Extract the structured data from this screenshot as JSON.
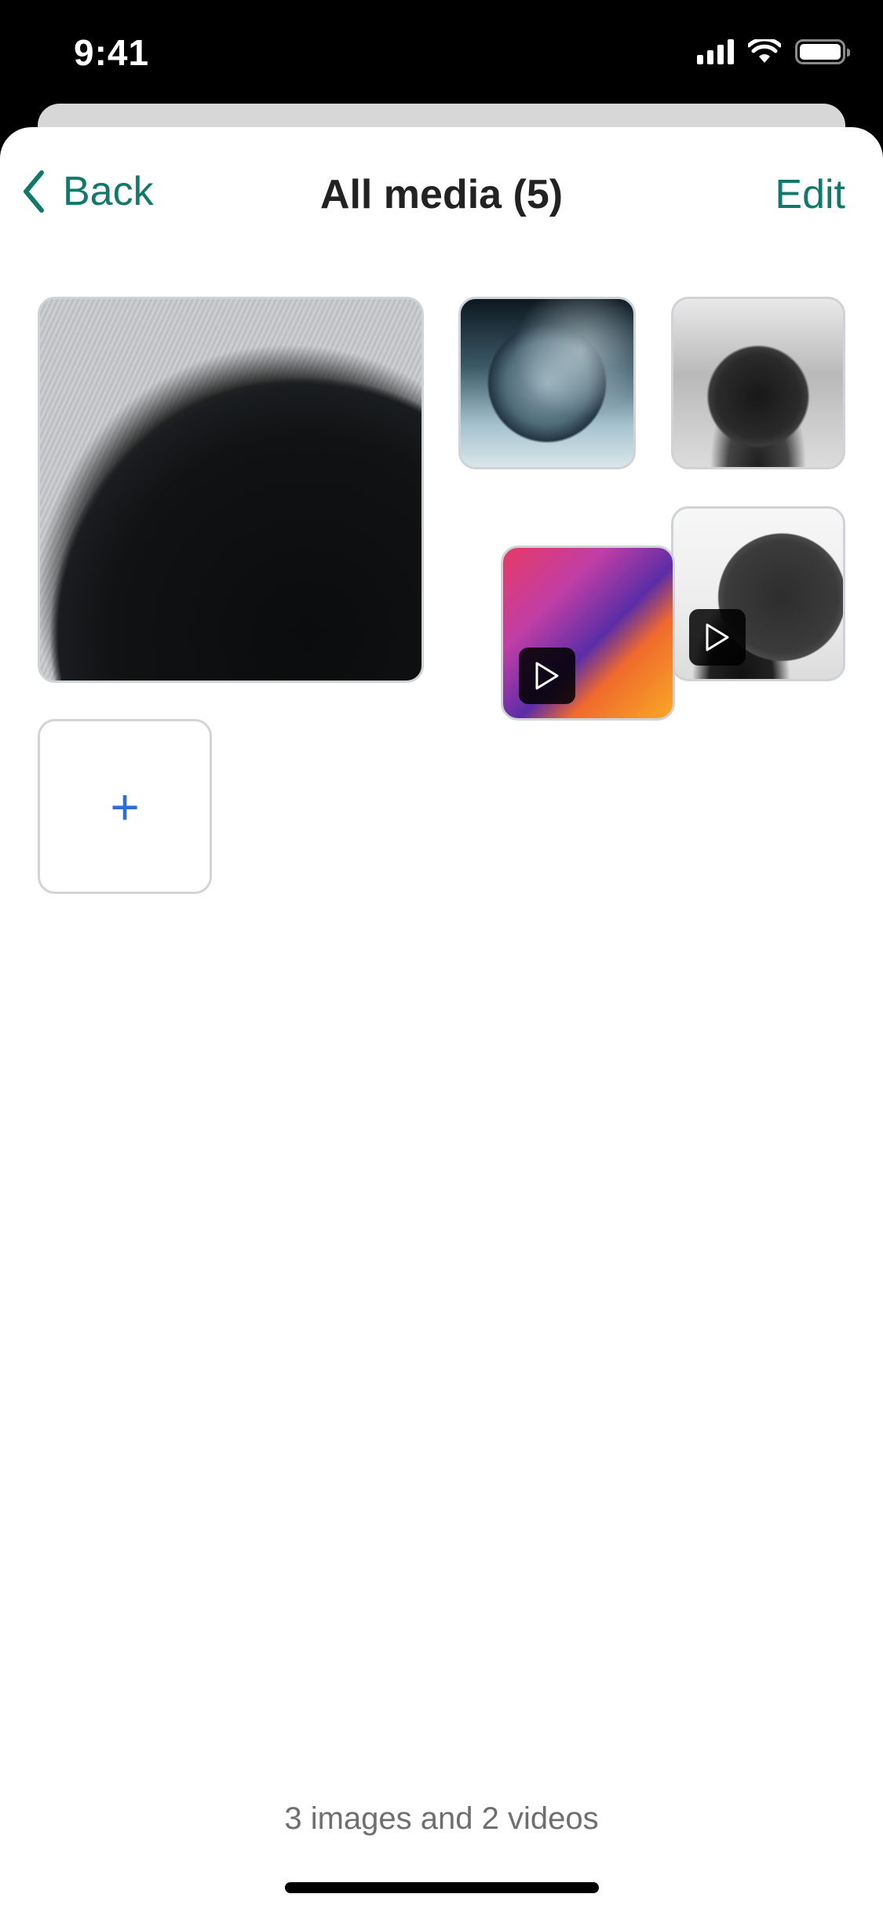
{
  "status_bar": {
    "time": "9:41",
    "icons": [
      "cellular-signal-icon",
      "wifi-icon",
      "battery-icon"
    ]
  },
  "nav": {
    "back_label": "Back",
    "title": "All media (5)",
    "edit_label": "Edit"
  },
  "media": [
    {
      "type": "image",
      "description": "dark sphere close-up"
    },
    {
      "type": "image",
      "description": "moon in fog"
    },
    {
      "type": "image",
      "description": "black sphere in smoke"
    },
    {
      "type": "video",
      "description": "gradient clip"
    },
    {
      "type": "video",
      "description": "black sphere on white"
    }
  ],
  "add_button": {
    "icon": "plus-icon",
    "glyph": "+"
  },
  "footer": {
    "summary": "3 images and 2 videos"
  },
  "colors": {
    "accent": "#0f7a68",
    "add_icon": "#2d6ed6"
  }
}
